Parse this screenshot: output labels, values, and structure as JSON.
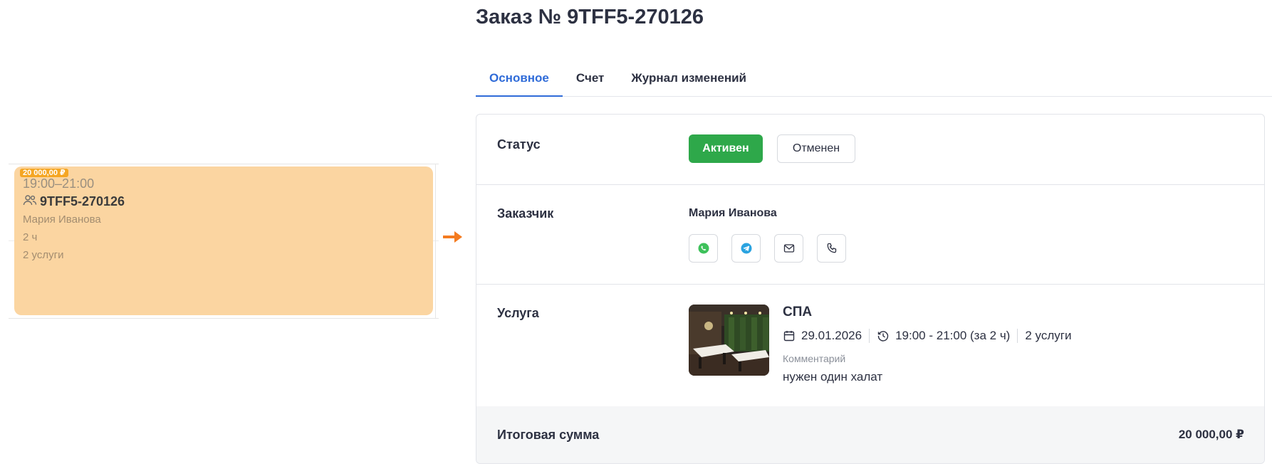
{
  "calendar_card": {
    "price": "20 000,00 ₽",
    "time": "19:00–21:00",
    "order_number": "9TFF5-270126",
    "customer": "Мария Иванова",
    "duration": "2 ч",
    "services": "2 услуги",
    "color": "#fbd5a1"
  },
  "order": {
    "title": "Заказ № 9TFF5-270126"
  },
  "tabs": [
    {
      "label": "Основное",
      "active": true
    },
    {
      "label": "Счет",
      "active": false
    },
    {
      "label": "Журнал изменений",
      "active": false
    }
  ],
  "status": {
    "label": "Статус",
    "active_button": "Активен",
    "cancel_button": "Отменен",
    "active_color": "#2ea84a"
  },
  "customer": {
    "label": "Заказчик",
    "name": "Мария Иванова",
    "contacts": [
      "whatsapp-icon",
      "telegram-icon",
      "email-icon",
      "phone-icon"
    ]
  },
  "service": {
    "label": "Услуга",
    "name": "СПА",
    "date": "29.01.2026",
    "time": "19:00 - 21:00 (за 2 ч)",
    "count": "2 услуги",
    "comment_label": "Комментарий",
    "comment": "нужен один халат"
  },
  "total": {
    "label": "Итоговая сумма",
    "value": "20 000,00 ₽"
  },
  "accent_color": "#2f6bd8"
}
